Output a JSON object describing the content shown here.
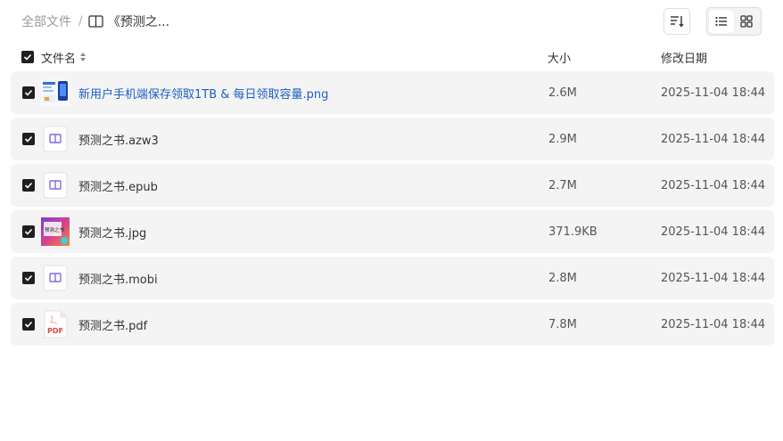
{
  "breadcrumb": {
    "root": "全部文件",
    "separator": "/",
    "current": "《预测之..."
  },
  "toolbar": {
    "sort_icon": "sort-lines-icon",
    "list_view_icon": "list-view-icon",
    "grid_view_icon": "grid-view-icon"
  },
  "table": {
    "columns": {
      "name": "文件名",
      "size": "大小",
      "date": "修改日期"
    },
    "rows": [
      {
        "name": "新用户手机端保存领取1TB & 每日领取容量.png",
        "size": "2.6M",
        "date": "2025-11-04 18:44",
        "icon": "image-thumbnail-icon",
        "link": true
      },
      {
        "name": "预测之书.azw3",
        "size": "2.9M",
        "date": "2025-11-04 18:44",
        "icon": "ebook-file-icon"
      },
      {
        "name": "预测之书.epub",
        "size": "2.7M",
        "date": "2025-11-04 18:44",
        "icon": "ebook-file-icon"
      },
      {
        "name": "预测之书.jpg",
        "size": "371.9KB",
        "date": "2025-11-04 18:44",
        "icon": "book-cover-thumbnail-icon",
        "thumb_text": "预测之书"
      },
      {
        "name": "预测之书.mobi",
        "size": "2.8M",
        "date": "2025-11-04 18:44",
        "icon": "ebook-file-icon"
      },
      {
        "name": "预测之书.pdf",
        "size": "7.8M",
        "date": "2025-11-04 18:44",
        "icon": "pdf-file-icon",
        "badge": "PDF"
      }
    ]
  },
  "colors": {
    "row_bg": "#f4f4f5",
    "link": "#1d5fc0",
    "checkbox": "#1f1f1f",
    "ebook_icon": "#7b6fe0",
    "pdf_icon": "#e0443c"
  }
}
